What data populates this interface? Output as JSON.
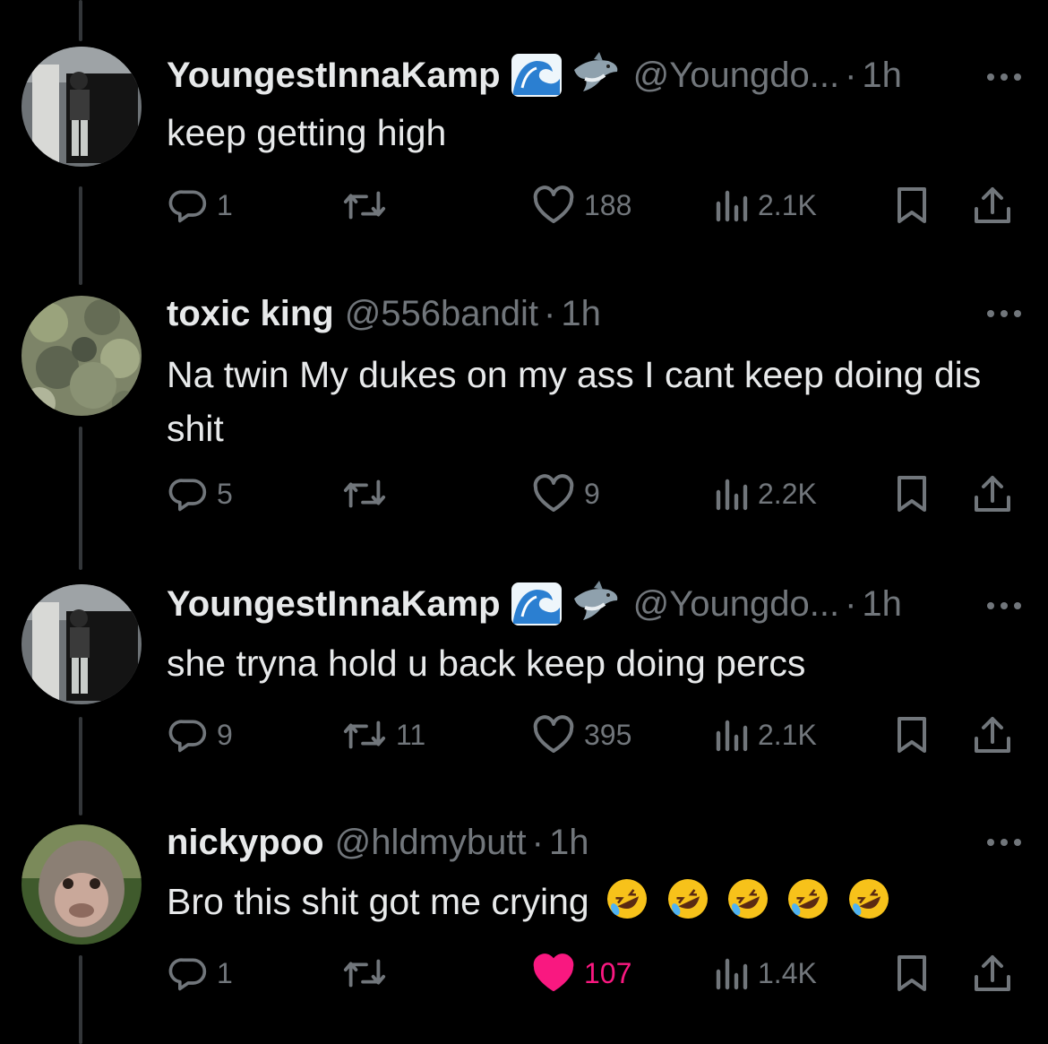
{
  "tweets": [
    {
      "display_name": "YoungestInnaKamp",
      "name_emojis": [
        "wave-emoji",
        "shark-emoji"
      ],
      "handle": "@Youngdo...",
      "separator": "·",
      "time": "1h",
      "text": "keep getting high",
      "replies": "1",
      "retweets": "",
      "likes": "188",
      "views": "2.1K",
      "liked": false
    },
    {
      "display_name": "toxic king",
      "name_emojis": [],
      "handle": "@556bandit",
      "separator": "·",
      "time": "1h",
      "text": "Na twin My dukes on my ass I cant keep doing dis shit",
      "replies": "5",
      "retweets": "",
      "likes": "9",
      "views": "2.2K",
      "liked": false
    },
    {
      "display_name": "YoungestInnaKamp",
      "name_emojis": [
        "wave-emoji",
        "shark-emoji"
      ],
      "handle": "@Youngdo...",
      "separator": "·",
      "time": "1h",
      "text": "she tryna hold u back keep doing percs",
      "replies": "9",
      "retweets": "11",
      "likes": "395",
      "views": "2.1K",
      "liked": false
    },
    {
      "display_name": "nickypoo",
      "name_emojis": [],
      "handle": "@hldmybutt",
      "separator": "·",
      "time": "1h",
      "text": "Bro this shit got me crying",
      "text_emojis": [
        "rolling-on-floor-laughing-emoji",
        "rolling-on-floor-laughing-emoji",
        "rolling-on-floor-laughing-emoji",
        "rolling-on-floor-laughing-emoji",
        "rolling-on-floor-laughing-emoji"
      ],
      "replies": "1",
      "retweets": "",
      "likes": "107",
      "views": "1.4K",
      "liked": true
    }
  ],
  "icons": {
    "reply": "reply-icon",
    "retweet": "retweet-icon",
    "like": "heart-icon",
    "views": "views-icon",
    "bookmark": "bookmark-icon",
    "share": "share-icon",
    "more": "more-icon"
  },
  "colors": {
    "background": "#000000",
    "text_primary": "#e7e9ea",
    "text_secondary": "#71767b",
    "like_active": "#f91880",
    "thread_line": "#333639"
  }
}
